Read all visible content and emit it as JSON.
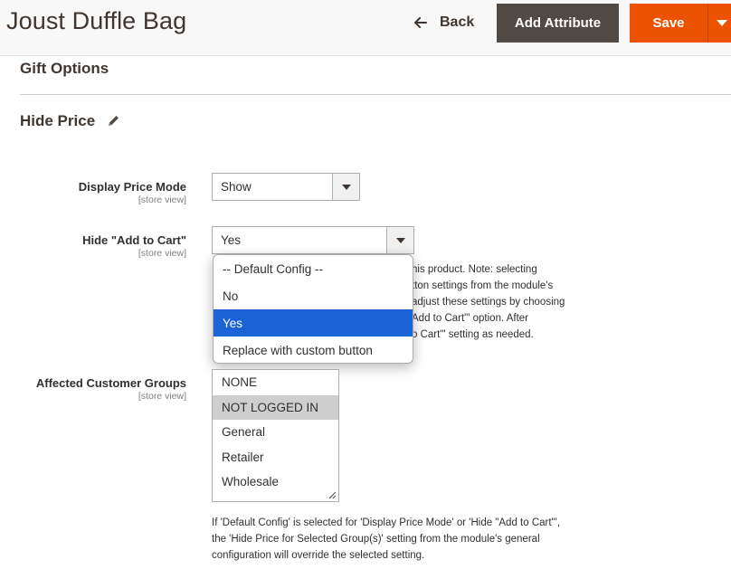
{
  "header": {
    "title": "Joust Duffle Bag",
    "back_label": "Back",
    "add_attribute_label": "Add Attribute",
    "save_label": "Save"
  },
  "sections": {
    "gift_options": "Gift Options",
    "hide_price": "Hide Price"
  },
  "fields": {
    "display_price_mode": {
      "label": "Display Price Mode",
      "scope": "[store view]",
      "value": "Show"
    },
    "hide_add_to_cart": {
      "label": "Hide \"Add to Cart\"",
      "scope": "[store view]",
      "value": "Yes",
      "note_lines": [
        "his product. Note: selecting",
        "tton settings from the module's",
        "adjust these settings by choosing",
        "Add to Cart\"' option. After",
        "o Cart\"' setting as needed."
      ],
      "options": [
        "-- Default Config --",
        "No",
        "Yes",
        "Replace with custom button"
      ],
      "highlighted_option": "Yes"
    },
    "affected_customer_groups": {
      "label": "Affected Customer Groups",
      "scope": "[store view]",
      "options": [
        "NONE",
        "NOT LOGGED IN",
        "General",
        "Retailer",
        "Wholesale"
      ],
      "selected": [
        "NOT LOGGED IN"
      ],
      "note_lines": [
        "If 'Default Config' is selected for 'Display Price Mode' or 'Hide \"Add to Cart\"',",
        "the 'Hide Price for Selected Group(s)' setting from the module's general",
        "configuration will override the selected setting."
      ]
    }
  },
  "icons": {
    "back": "arrow-left-icon",
    "save_toggle": "caret-down-icon",
    "edit": "pencil-icon",
    "select_arrow": "caret-down-icon",
    "resize": "resize-handle-icon"
  },
  "colors": {
    "primary": "#eb5202",
    "secondary": "#514943",
    "highlight": "#1a62d6",
    "multiselect_selected": "#cecece"
  }
}
